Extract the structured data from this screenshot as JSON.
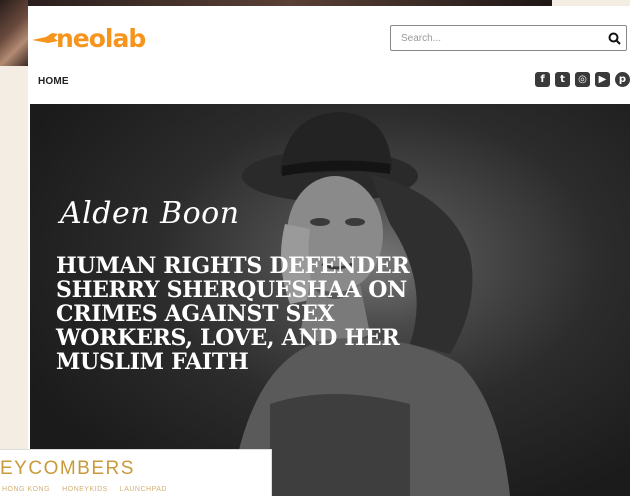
{
  "site": {
    "logo_text": "neolab",
    "search_placeholder": "Search..."
  },
  "nav": {
    "home_label": "HOME"
  },
  "social": [
    {
      "name": "facebook-icon",
      "glyph": "f"
    },
    {
      "name": "twitter-icon",
      "glyph": "t"
    },
    {
      "name": "instagram-icon",
      "glyph": "◎"
    },
    {
      "name": "youtube-icon",
      "glyph": "▶"
    },
    {
      "name": "pinterest-icon",
      "glyph": "p"
    }
  ],
  "hero": {
    "author": "Alden Boon",
    "headline": "HUMAN RIGHTS DEFENDER SHERRY SHERQUESHAA ON CRIMES AGAINST SEX WORKERS, LOVE, AND HER MUSLIM FAITH"
  },
  "banner": {
    "brand": "EYCOMBERS",
    "links": [
      "HONG KONG",
      "HONEYKIDS",
      "LAUNCHPAD"
    ]
  },
  "colors": {
    "brand_orange": "#f7941d",
    "banner_gold": "#c89a3a"
  }
}
